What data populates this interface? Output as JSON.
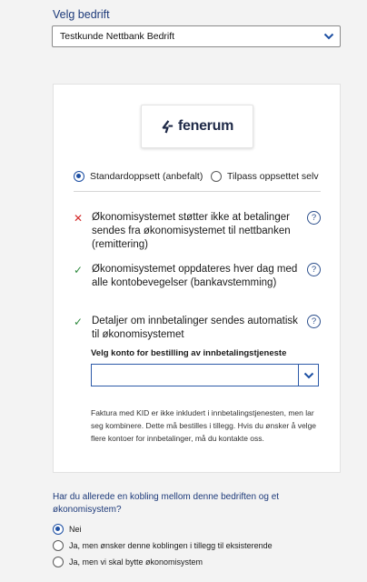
{
  "company": {
    "label": "Velg bedrift",
    "selected": "Testkunde Nettbank Bedrift"
  },
  "provider": {
    "logo_text": "fenerum",
    "logo_suffix": "·"
  },
  "setup": {
    "options": [
      "Standardoppsett (anbefalt)",
      "Tilpass oppsettet selv"
    ],
    "selected_index": 0
  },
  "features": [
    {
      "status": "unsupported",
      "icon": "cross-icon",
      "text": "Økonomisystemet støtter ikke at betalinger sendes fra økonomisystemet til nettbanken (remittering)"
    },
    {
      "status": "supported",
      "icon": "check-icon",
      "text": "Økonomisystemet oppdateres hver dag med alle kontobevegelser (bankavstemming)"
    },
    {
      "status": "supported",
      "icon": "check-icon",
      "text": "Detaljer om innbetalinger sendes automatisk til økonomisystemet"
    }
  ],
  "glyphs": {
    "cross": "✕",
    "check": "✓",
    "help": "?"
  },
  "account": {
    "label": "Velg konto for bestilling av innbetalingstjeneste",
    "value": ""
  },
  "note": "Faktura med KID er ikke inkludert i innbetalingstjenesten, men lar seg kombinere. Dette må bestilles i tillegg. Hvis du ønsker å velge flere kontoer for innbetalinger, må du kontakte oss.",
  "question": {
    "label": "Har du allerede en kobling mellom denne bedriften og et økonomisystem?",
    "options": [
      "Nei",
      "Ja, men ønsker denne koblingen i tillegg til eksisterende",
      "Ja, men vi skal bytte økonomisystem"
    ],
    "selected_index": 0
  },
  "colors": {
    "accent": "#1d4fa3",
    "label_blue": "#1d3a7a",
    "error": "#d42a2a",
    "success": "#2e8a3e"
  }
}
